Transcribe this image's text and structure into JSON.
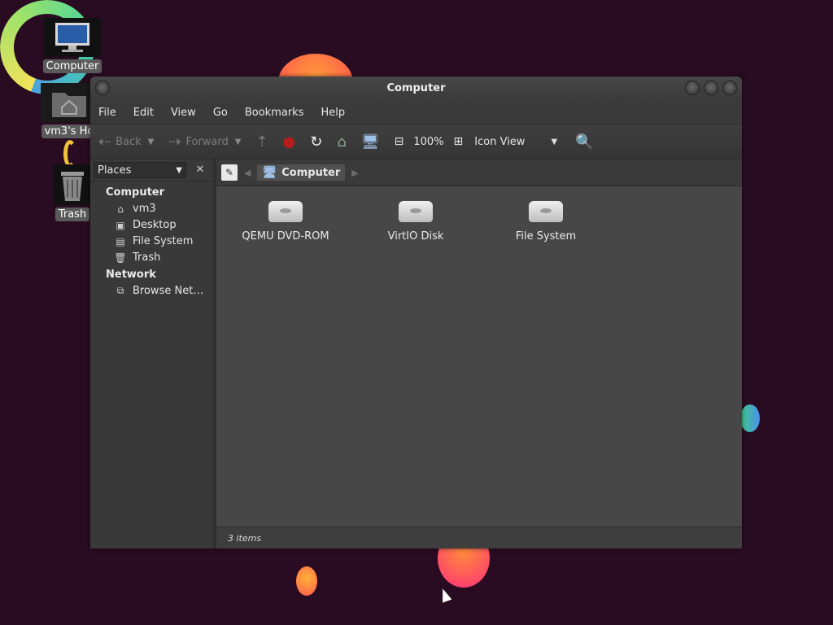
{
  "desktop": {
    "icons": [
      {
        "label": "Computer",
        "icon": "computer-icon"
      },
      {
        "label": "vm3's Ho",
        "icon": "home-folder-icon"
      },
      {
        "label": "Trash",
        "icon": "trash-icon"
      }
    ]
  },
  "window": {
    "title": "Computer",
    "menu": [
      "File",
      "Edit",
      "View",
      "Go",
      "Bookmarks",
      "Help"
    ],
    "toolbar": {
      "back_label": "Back",
      "forward_label": "Forward",
      "zoom": "100%",
      "view_mode": "Icon View"
    },
    "sidebar": {
      "selector": "Places",
      "sections": [
        {
          "heading": "Computer",
          "items": [
            {
              "label": "vm3",
              "icon": "home-icon"
            },
            {
              "label": "Desktop",
              "icon": "desktop-icon"
            },
            {
              "label": "File System",
              "icon": "drive-icon"
            },
            {
              "label": "Trash",
              "icon": "trash-icon"
            }
          ]
        },
        {
          "heading": "Network",
          "items": [
            {
              "label": "Browse Net…",
              "icon": "network-icon"
            }
          ]
        }
      ]
    },
    "location": {
      "crumb": "Computer"
    },
    "items": [
      {
        "label": "QEMU DVD-ROM",
        "icon": "optical-drive-icon"
      },
      {
        "label": "VirtIO Disk",
        "icon": "hard-disk-icon"
      },
      {
        "label": "File System",
        "icon": "hard-disk-icon"
      }
    ],
    "status": "3 items"
  }
}
